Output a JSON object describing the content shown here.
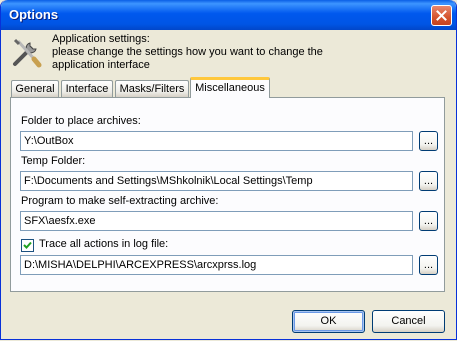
{
  "window": {
    "title": "Options"
  },
  "header": {
    "line1": "Application settings:",
    "line2": "please change the settings how you want to change the",
    "line3": "application interface"
  },
  "tabs": [
    "General",
    "Interface",
    "Masks/Filters",
    "Miscellaneous"
  ],
  "active_tab": "Miscellaneous",
  "fields": {
    "archives_label": "Folder to place archives:",
    "archives_value": "Y:\\OutBox",
    "temp_label": "Temp Folder:",
    "temp_value": "F:\\Documents and Settings\\MShkolnik\\Local Settings\\Temp",
    "sfx_label": "Program to make self-extracting archive:",
    "sfx_value": "SFX\\aesfx.exe",
    "log_label": "Trace all actions in log file:",
    "log_checked": true,
    "log_value": "D:\\MISHA\\DELPHI\\ARCEXPRESS\\arcxprss.log"
  },
  "browse_label": "...",
  "buttons": {
    "ok": "OK",
    "cancel": "Cancel"
  },
  "icons": {
    "close": "close-icon",
    "tools": "tools-icon",
    "check": "checkmark-icon"
  },
  "colors": {
    "titlebar": "#0058EE",
    "tab_highlight": "#FFC83C",
    "dialog_bg": "#ECE9D8"
  }
}
